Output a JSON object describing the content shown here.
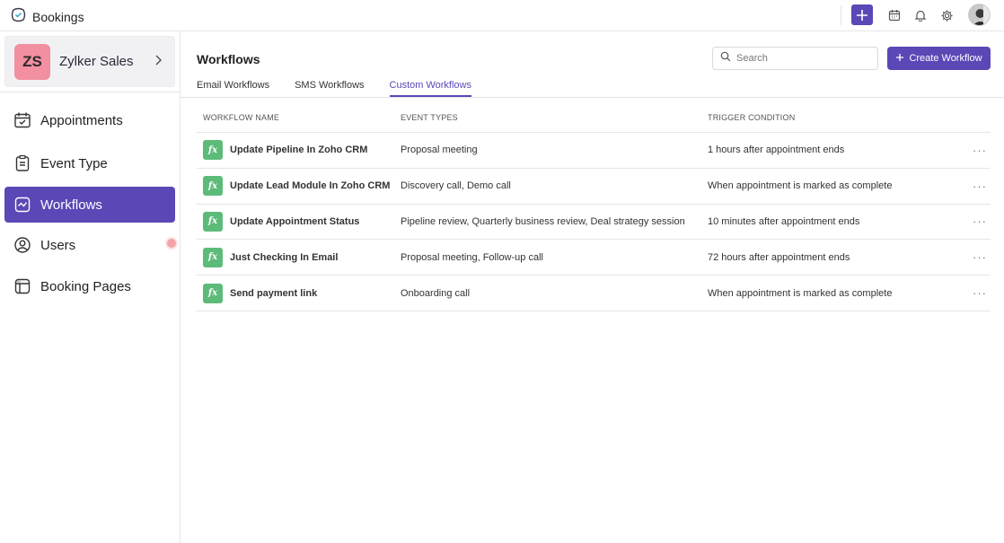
{
  "app": {
    "title": "Bookings"
  },
  "org": {
    "initials": "ZS",
    "name": "Zylker Sales",
    "badge_color": "#f28fa0"
  },
  "theme": {
    "accent": "#5b47b5",
    "fx_green": "#5dbb7a"
  },
  "sidebar": {
    "items": [
      {
        "label": "Appointments",
        "icon": "calendar-check-icon",
        "active": false
      },
      {
        "label": "Event Type",
        "icon": "clipboard-icon",
        "active": false
      },
      {
        "label": "Workflows",
        "icon": "workflow-icon",
        "active": true
      },
      {
        "label": "Users",
        "icon": "user-circle-icon",
        "active": false
      },
      {
        "label": "Booking Pages",
        "icon": "booking-page-icon",
        "active": false
      }
    ]
  },
  "main": {
    "title": "Workflows",
    "search": {
      "placeholder": "Search",
      "value": ""
    },
    "create_label": "Create Workflow",
    "tabs": [
      {
        "label": "Email Workflows",
        "active": false
      },
      {
        "label": "SMS Workflows",
        "active": false
      },
      {
        "label": "Custom Workflows",
        "active": true
      }
    ],
    "table": {
      "headers": [
        "WORKFLOW NAME",
        "EVENT TYPES",
        "TRIGGER CONDITION"
      ],
      "rows": [
        {
          "name": "Update Pipeline In Zoho CRM",
          "events": "Proposal meeting",
          "trigger": "1 hours after appointment ends"
        },
        {
          "name": "Update Lead Module In Zoho CRM",
          "events": "Discovery call, Demo call",
          "trigger": "When appointment is marked as complete"
        },
        {
          "name": "Update Appointment Status",
          "events": "Pipeline review, Quarterly business review, Deal strategy session",
          "trigger": "10 minutes after appointment ends"
        },
        {
          "name": "Just Checking In Email",
          "events": "Proposal meeting, Follow-up call",
          "trigger": "72 hours after appointment ends"
        },
        {
          "name": "Send payment link",
          "events": "Onboarding call",
          "trigger": "When appointment is marked as complete"
        }
      ]
    }
  }
}
